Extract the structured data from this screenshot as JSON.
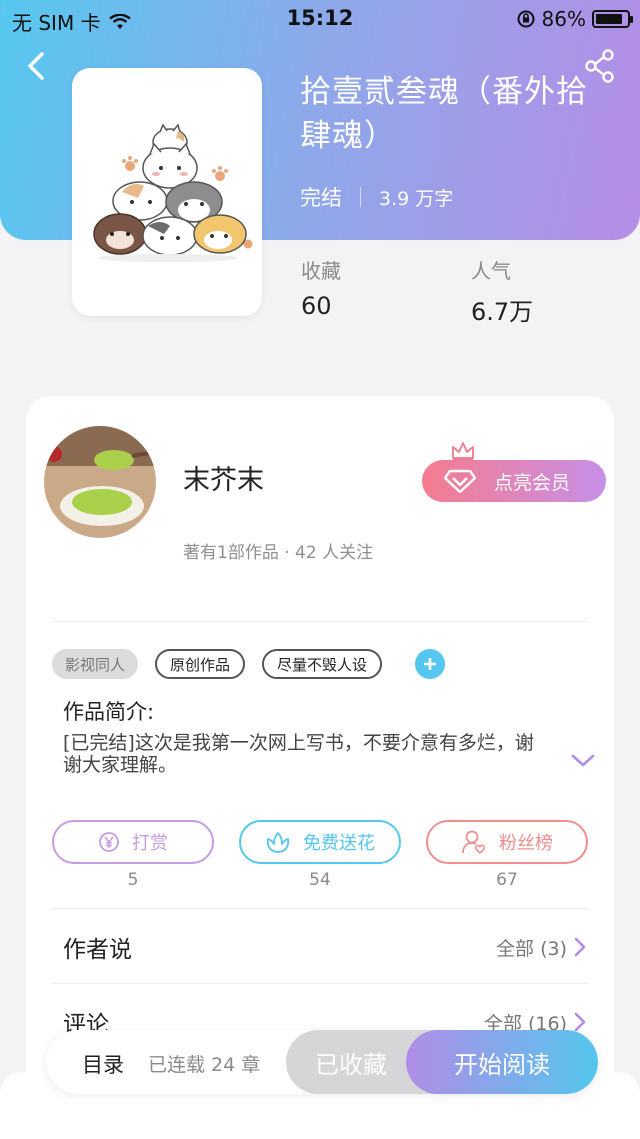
{
  "status": {
    "carrier": "无 SIM 卡",
    "time": "15:12",
    "battery": "86%",
    "battery_level": 0.86
  },
  "book": {
    "title": "拾壹贰叁魂（番外拾肆魂）",
    "status": "完结",
    "word_count": "3.9 万字"
  },
  "stats": [
    {
      "label": "收藏",
      "value": "60"
    },
    {
      "label": "人气",
      "value": "6.7万"
    }
  ],
  "author": {
    "name": "末芥末",
    "info": "著有1部作品 · 42 人关注",
    "vip_label": "点亮会员"
  },
  "tags": [
    "影视同人",
    "原创作品",
    "尽量不毁人设"
  ],
  "intro": {
    "title": "作品简介:",
    "text": "[已完结]这次是我第一次网上写书，不要介意有多烂，谢谢大家理解。"
  },
  "actions": [
    {
      "label": "打赏",
      "count": "5",
      "color": "#c79be4"
    },
    {
      "label": "免费送花",
      "count": "54",
      "color": "#55c6ef"
    },
    {
      "label": "粉丝榜",
      "count": "67",
      "color": "#ef8e8e"
    }
  ],
  "rows": [
    {
      "label": "作者说",
      "right": "全部 (3)"
    },
    {
      "label": "评论",
      "right": "全部 (16)"
    }
  ],
  "bottom": {
    "toc": "目录",
    "serial": "已连载 24 章",
    "collected": "已收藏",
    "read": "开始阅读"
  }
}
